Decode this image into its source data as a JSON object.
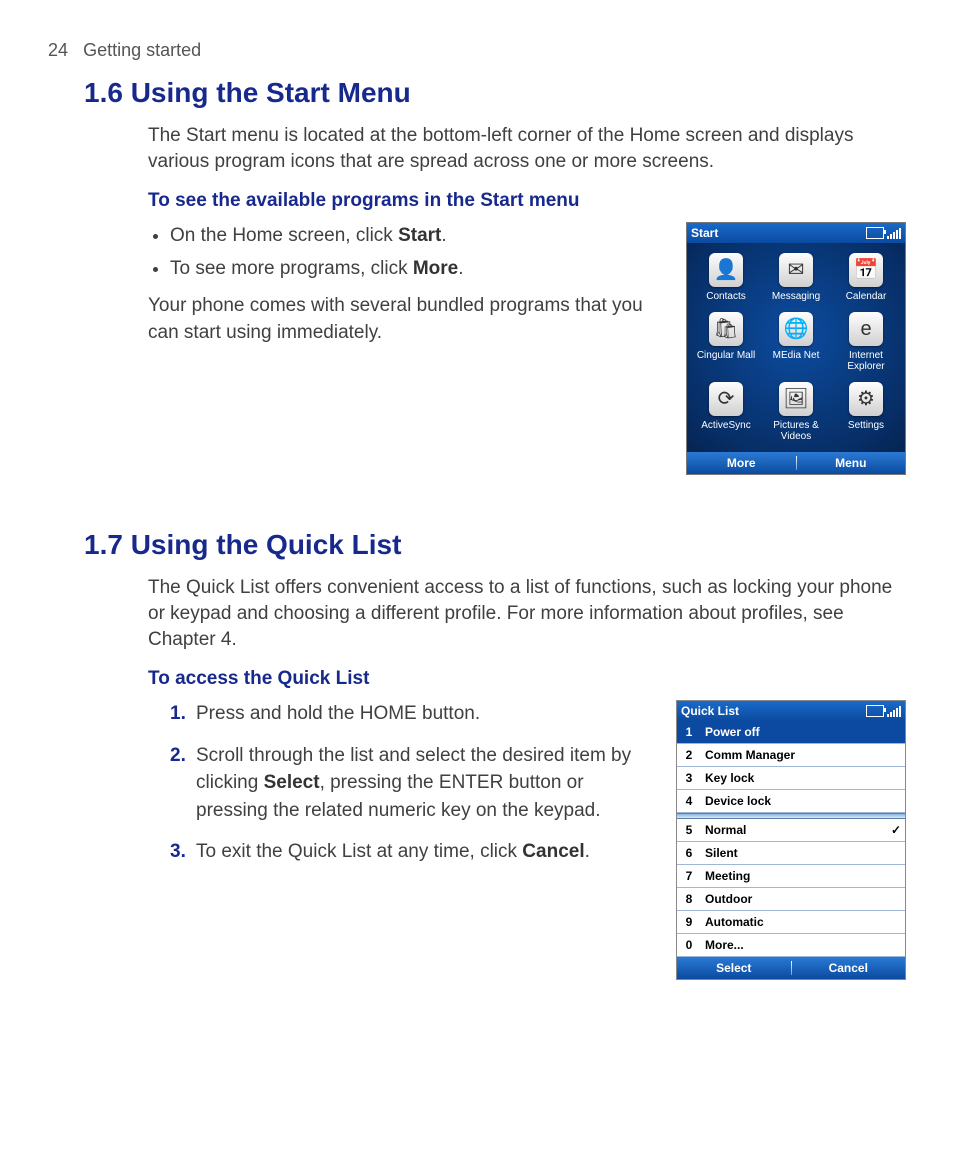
{
  "page": {
    "number": "24",
    "section": "Getting started"
  },
  "s16": {
    "title": "1.6 Using the Start Menu",
    "intro": "The Start menu is located at the bottom-left corner of the Home screen and displays various program icons that are spread across one or more screens.",
    "subtitle": "To see the available programs in the Start menu",
    "bullet1_a": "On the Home screen, click ",
    "bullet1_b": "Start",
    "bullet1_c": ".",
    "bullet2_a": "To see more programs, click ",
    "bullet2_b": "More",
    "bullet2_c": ".",
    "note": "Your phone comes with several bundled programs that you can start using immediately."
  },
  "phone1": {
    "title": "Start",
    "apps": [
      {
        "label": "Contacts",
        "glyph": "👤"
      },
      {
        "label": "Messaging",
        "glyph": "✉"
      },
      {
        "label": "Calendar",
        "glyph": "📅"
      },
      {
        "label": "Cingular Mall",
        "glyph": "🛍"
      },
      {
        "label": "MEdia Net",
        "glyph": "🌐"
      },
      {
        "label": "Internet Explorer",
        "glyph": "e"
      },
      {
        "label": "ActiveSync",
        "glyph": "⟳"
      },
      {
        "label": "Pictures & Videos",
        "glyph": "🖼"
      },
      {
        "label": "Settings",
        "glyph": "⚙"
      }
    ],
    "soft_left": "More",
    "soft_right": "Menu"
  },
  "s17": {
    "title": "1.7 Using the Quick List",
    "intro": "The Quick List offers convenient access to a list of functions, such as locking your phone or keypad and choosing a different profile. For more information about profiles, see Chapter 4.",
    "subtitle": "To access the Quick List",
    "step1": "Press and hold the HOME button.",
    "step2_a": "Scroll through the list and select the desired item by clicking ",
    "step2_b": "Select",
    "step2_c": ", pressing the ENTER button or pressing the related numeric key on the keypad.",
    "step3_a": "To exit the Quick List at any time, click ",
    "step3_b": "Cancel",
    "step3_c": "."
  },
  "phone2": {
    "title": "Quick List",
    "items": [
      {
        "n": "1",
        "t": "Power off",
        "selected": true
      },
      {
        "n": "2",
        "t": "Comm Manager"
      },
      {
        "n": "3",
        "t": "Key lock"
      },
      {
        "n": "4",
        "t": "Device lock"
      },
      {
        "n": "5",
        "t": "Normal",
        "check": true
      },
      {
        "n": "6",
        "t": "Silent"
      },
      {
        "n": "7",
        "t": "Meeting"
      },
      {
        "n": "8",
        "t": "Outdoor"
      },
      {
        "n": "9",
        "t": "Automatic"
      },
      {
        "n": "0",
        "t": "More..."
      }
    ],
    "soft_left": "Select",
    "soft_right": "Cancel"
  }
}
